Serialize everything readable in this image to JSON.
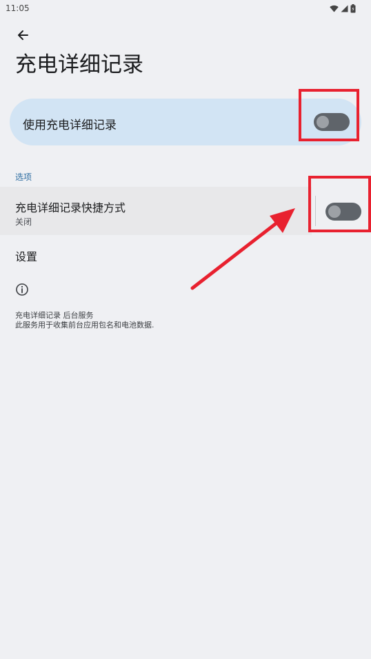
{
  "status_bar": {
    "time": "11:05",
    "icons": [
      "wifi-icon",
      "signal-icon",
      "battery-icon"
    ]
  },
  "header": {
    "back_icon": "arrow-back-icon",
    "title": "充电详细记录"
  },
  "main_switch": {
    "label": "使用充电详细记录",
    "state": "off"
  },
  "options": {
    "section_title": "选项",
    "shortcut": {
      "title": "充电详细记录快捷方式",
      "summary": "关闭",
      "state": "off"
    },
    "settings_label": "设置"
  },
  "footer": {
    "icon": "info-icon",
    "line1": "充电详细记录 后台服务",
    "line2": "此服务用于收集前台应用包名和电池数据."
  },
  "annotations": {
    "highlight_color": "#e8212f"
  },
  "colors": {
    "background": "#eff0f3",
    "card": "#d2e4f4",
    "accent": "#2f6ea2",
    "toggle_off_track": "#5f646a",
    "toggle_off_thumb": "#9da1a6"
  }
}
